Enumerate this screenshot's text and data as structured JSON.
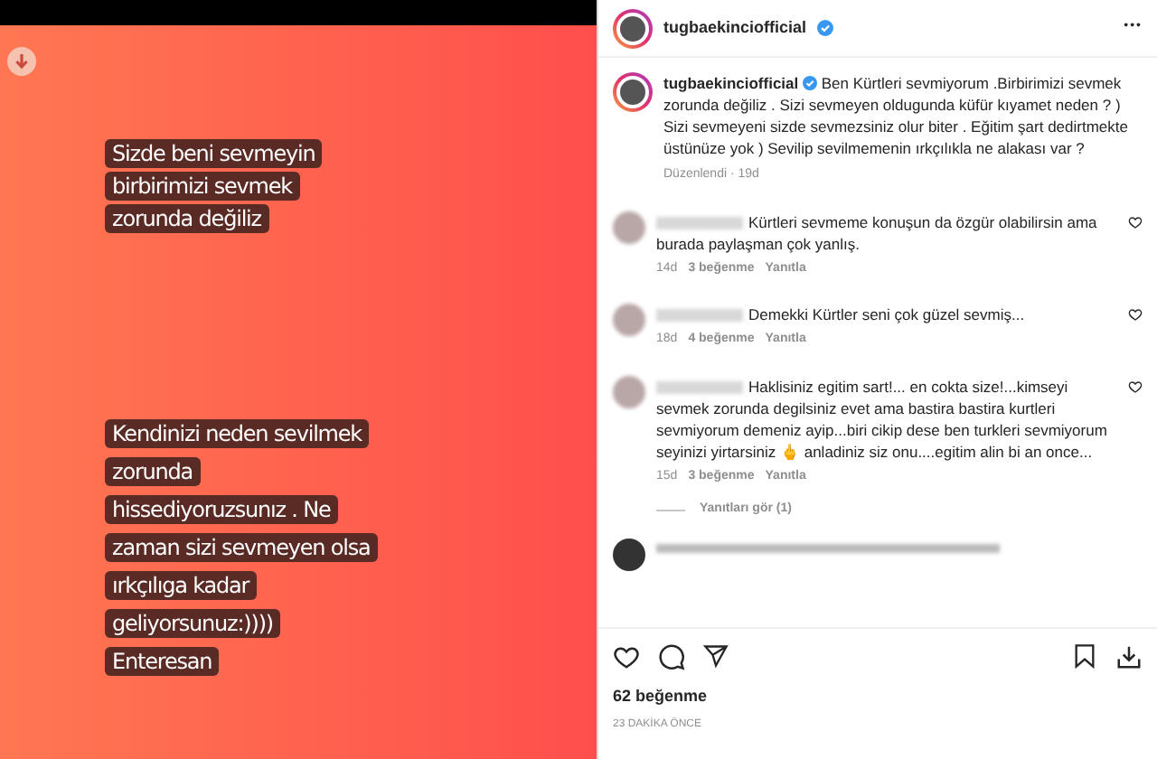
{
  "story": {
    "stickers": [
      "Sizde beni sevmeyin\nbirbirimizi sevmek\nzorunda  değiliz",
      "Kendinizi neden sevilmek\nzorunda\nhissediyoruzsunız . Ne\nzaman sizi sevmeyen olsa\nırkçılıga kadar\ngeliyorsunuz:))))\nEnteresan"
    ]
  },
  "header": {
    "username": "tugbaekinciofficial",
    "verified": true,
    "more": "•••"
  },
  "caption": {
    "username": "tugbaekinciofficial",
    "verified": true,
    "text": "Ben Kürtleri sevmiyorum .Birbirimizi sevmek zorunda değiliz . Sizi sevmeyen oldugunda küfür kıyamet neden ? ) Sizi sevmeyeni sizde sevmezsiniz olur biter . Eğitim şart dedirtmekte üstünüze yok ) Sevilip sevilmemenin ırkçılıkla ne alakası var ?",
    "meta": "Düzenlendi · 19d"
  },
  "comments": [
    {
      "text": "Kürtleri sevmeme konuşun da özgür olabilirsin ama burada paylaşman çok yanlış.",
      "time": "14d",
      "likes": "3 beğenme",
      "reply": "Yanıtla",
      "liked": false
    },
    {
      "text": "Demekki Kürtler seni çok güzel sevmiş...",
      "time": "18d",
      "likes": "4 beğenme",
      "reply": "Yanıtla",
      "liked": false
    },
    {
      "text": "Haklisiniz egitim sart!... en cokta size!...kimseyi sevmek zorunda degilsiniz evet ama bastira bastira kurtleri sevmiyorum demeniz ayip...biri cikip dese ben turkleri sevmiyorum seyinizi yirtarsiniz 🖕 anladiniz siz onu....egitim alin bi an once...",
      "time": "15d",
      "likes": "3 beğenme",
      "reply": "Yanıtla",
      "liked": false,
      "replies_link": "Yanıtları gör (1)"
    }
  ],
  "actions": {
    "liked": false,
    "saved": false
  },
  "likes": "62 beğenme",
  "timestamp": "23 DAKİKA ÖNCE"
}
